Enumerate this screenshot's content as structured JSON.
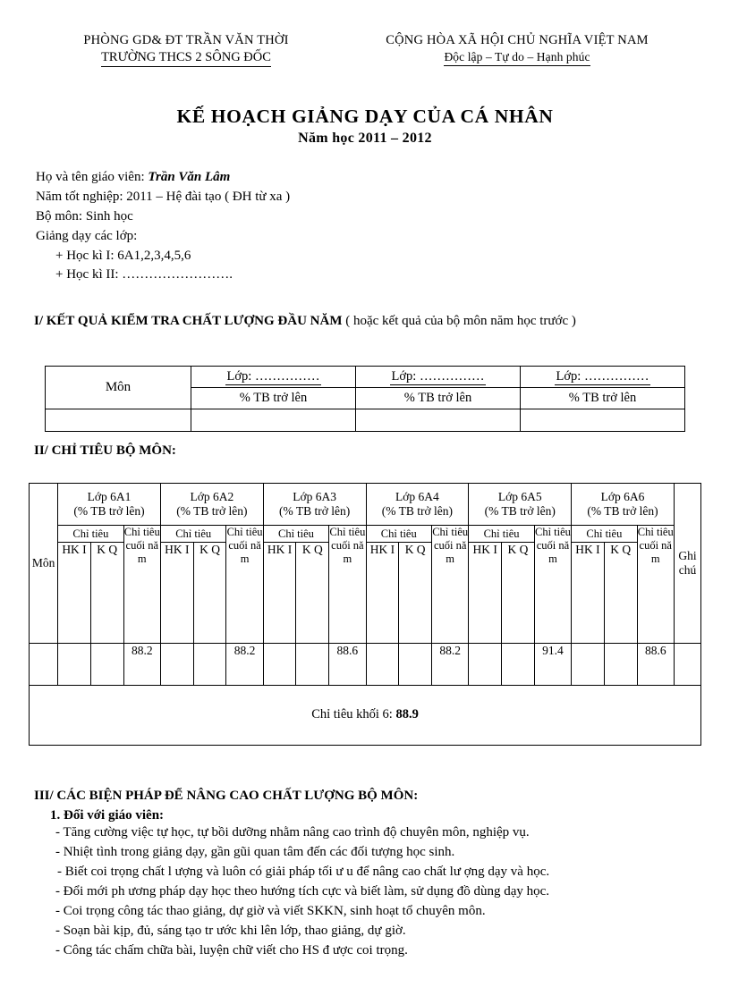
{
  "header": {
    "left_line1": "PHÒNG GD& ĐT TRẦN VĂN THỜI",
    "left_line2": "TRƯỜNG THCS 2 SÔNG ĐỐC",
    "right_line1": "CỘNG HÒA XÃ HỘI CHỦ NGHĨA VIỆT NAM",
    "right_line2": "Độc lập – Tự do – Hạnh phúc"
  },
  "title": {
    "main": "KẾ HOẠCH GIẢNG DẠY CỦA CÁ NHÂN",
    "sub": "Năm học 2011 – 2012"
  },
  "info": {
    "teacher_label": "Họ và tên giáo viên:",
    "teacher_name": "Trần Văn Lâm",
    "graduation": "Năm tốt nghiệp: 2011 – Hệ đài tạo ( ĐH từ xa )",
    "subject": "Bộ môn: Sinh học",
    "classes_label": "Giảng dạy các lớp:",
    "term1": "+ Học kì I: 6A1,2,3,4,5,6",
    "term2": "+ Học kì II: ……………………."
  },
  "section1": {
    "heading_bold": "I/ KẾT QUẢ KIỂM TRA CHẤT LƯỢNG ĐẦU NĂM",
    "heading_normal": " ( hoặc kết quả của bộ môn năm học trước )",
    "table": {
      "col_mon": "Môn",
      "lop_label": "Lớp: ……………",
      "tb_label": "% TB trở lên",
      "class_columns": [
        "Lớp: ……………",
        "Lớp: ……………",
        "Lớp: ……………"
      ],
      "data_row": [
        "",
        "",
        "",
        ""
      ]
    }
  },
  "section2": {
    "heading": "II/ CHỈ TIÊU BỘ MÔN:",
    "table": {
      "col_mon": "Môn",
      "col_ghichu": "Ghi chú",
      "groups": [
        {
          "name": "Lớp 6A1",
          "note": "(% TB trở lên)"
        },
        {
          "name": "Lớp 6A2",
          "note": "(% TB trở lên)"
        },
        {
          "name": "Lớp 6A3",
          "note": "(% TB trở lên)"
        },
        {
          "name": "Lớp 6A4",
          "note": "(% TB trở lên)"
        },
        {
          "name": "Lớp 6A5",
          "note": "(% TB trở lên)"
        },
        {
          "name": "Lớp 6A6",
          "note": "(% TB trở lên)"
        }
      ],
      "chitieu_label": "Chỉ tiêu",
      "hk1_label": "HK I",
      "kq_label": "K Q",
      "cuoinam_label": "Chỉ tiêu cuối năm",
      "data": {
        "mon": "",
        "ghichu": "",
        "values": [
          {
            "hk1": "",
            "kq": "",
            "cuoinam": "88.2"
          },
          {
            "hk1": "",
            "kq": "",
            "cuoinam": "88.2"
          },
          {
            "hk1": "",
            "kq": "",
            "cuoinam": "88.6"
          },
          {
            "hk1": "",
            "kq": "",
            "cuoinam": "88.2"
          },
          {
            "hk1": "",
            "kq": "",
            "cuoinam": "91.4"
          },
          {
            "hk1": "",
            "kq": "",
            "cuoinam": "88.6"
          }
        ]
      },
      "summary_label": "Chỉ tiêu khối 6: ",
      "summary_value": "88.9"
    }
  },
  "section3": {
    "heading": "III/ CÁC BIỆN PHÁP ĐỂ NÂNG CAO CHẤT LƯỢNG BỘ MÔN:",
    "subheading": "1. Đối với giáo viên:",
    "bullets": [
      "- Tăng cường việc tự học, tự bồi dưỡng nhằm nâng cao trình độ chuyên môn, nghiệp vụ.",
      "- Nhiệt tình trong giảng dạy, gần gũi quan tâm đến các đối tượng học sinh.",
      "- Biết  coi trọng chất l    ượng và luôn có giải  pháp tối ư    u để nâng cao chất lư    ợng dạy và học.",
      "- Đổi mới ph    ương pháp dạy học theo hướng tích cực và biết làm, sử dụng đồ dùng dạy học.",
      "- Coi trọng công tác thao giảng,  dự giờ và viết  SKKN, sinh hoạt tổ chuyên môn.",
      "- Soạn bài kịp, đủ, sáng tạo tr    ước khi lên lớp, thao giảng,  dự giờ.",
      "- Công tác chấm chữa bài, luyện  chữ viết cho HS đ    ược coi trọng."
    ]
  }
}
